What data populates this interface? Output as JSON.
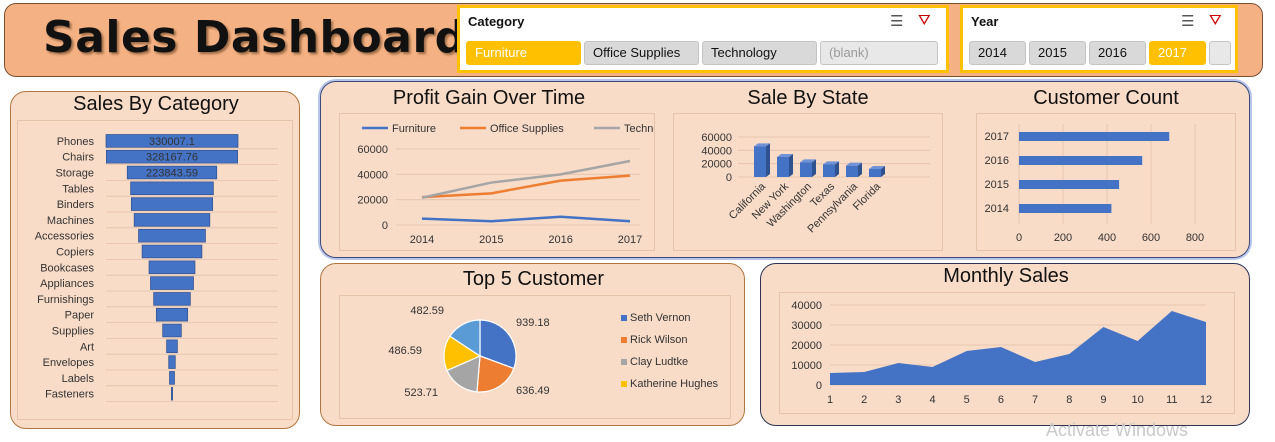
{
  "header": {
    "title": "Sales Dashboard"
  },
  "slicers": {
    "category": {
      "title": "Category",
      "options": [
        "Furniture",
        "Office Supplies",
        "Technology",
        "(blank)"
      ],
      "selected": "Furniture"
    },
    "year": {
      "title": "Year",
      "options": [
        "2014",
        "2015",
        "2016",
        "2017"
      ],
      "selected": "2017"
    },
    "icons": [
      "multi-select-icon",
      "clear-filter-icon"
    ]
  },
  "colors": {
    "accent": "#ffc000",
    "bar": "#4472c4",
    "orange": "#ed7d31",
    "gray": "#a5a5a5",
    "panel": "#f9dcc8",
    "header": "#f4b183"
  },
  "panels": {
    "sales_by_category": {
      "title": "Sales By Category"
    },
    "profit_gain": {
      "title": "Profit Gain Over Time"
    },
    "sale_by_state": {
      "title": "Sale By State"
    },
    "customer_count": {
      "title": "Customer Count"
    },
    "top5": {
      "title": "Top 5 Customer"
    },
    "monthly": {
      "title": "Monthly Sales"
    }
  },
  "watermark": "Activate Windows",
  "chart_data": [
    {
      "id": "sales_by_category",
      "type": "bar",
      "orientation": "horizontal-funnel",
      "title": "Sales By Category",
      "categories": [
        "Phones",
        "Chairs",
        "Storage",
        "Tables",
        "Binders",
        "Machines",
        "Accessories",
        "Copiers",
        "Bookcases",
        "Appliances",
        "Furnishings",
        "Paper",
        "Supplies",
        "Art",
        "Envelopes",
        "Labels",
        "Fasteners"
      ],
      "values": [
        330007.1,
        328167.76,
        223843.59,
        206965.53,
        203412.73,
        189238.63,
        167380.32,
        149528.03,
        114880.0,
        107532.16,
        91705.16,
        78479.21,
        46673.54,
        27118.79,
        16476.4,
        12486.31,
        3024.28
      ],
      "data_labels": [
        "330007.1",
        "328167.76",
        "223843.59"
      ]
    },
    {
      "id": "profit_gain",
      "type": "line",
      "title": "Profit Gain Over Time",
      "categories": [
        "2014",
        "2015",
        "2016",
        "2017"
      ],
      "series": [
        {
          "name": "Furniture",
          "color": "#4472c4",
          "values": [
            5000,
            3000,
            6500,
            3000
          ]
        },
        {
          "name": "Office Supplies",
          "color": "#ed7d31",
          "values": [
            22000,
            25000,
            35000,
            39000
          ]
        },
        {
          "name": "Technology",
          "color": "#a5a5a5",
          "values": [
            21500,
            33500,
            40000,
            50500
          ]
        }
      ],
      "yticks": [
        "0",
        "20000",
        "40000",
        "60000"
      ],
      "ylim": [
        0,
        60000
      ],
      "legend": "top"
    },
    {
      "id": "sale_by_state",
      "type": "bar",
      "title": "Sale By State",
      "categories": [
        "California",
        "New York",
        "Washington",
        "Texas",
        "Pennsylvania",
        "Florida"
      ],
      "values": [
        46000,
        30000,
        22000,
        19000,
        17000,
        12000
      ],
      "yticks": [
        "0",
        "20000",
        "40000",
        "60000"
      ],
      "ylim": [
        0,
        60000
      ]
    },
    {
      "id": "customer_count",
      "type": "bar",
      "orientation": "horizontal",
      "title": "Customer Count",
      "categories": [
        "2017",
        "2016",
        "2015",
        "2014"
      ],
      "values": [
        683,
        560,
        455,
        420
      ],
      "xticks": [
        "0",
        "200",
        "400",
        "600",
        "800"
      ],
      "xlim": [
        0,
        800
      ]
    },
    {
      "id": "top5",
      "type": "pie",
      "title": "Top 5 Customer",
      "labels": [
        "Seth Vernon",
        "Rick Wilson",
        "Clay Ludtke",
        "Katherine Hughes",
        ""
      ],
      "values": [
        939.18,
        636.49,
        523.71,
        486.59,
        482.59
      ],
      "value_labels": [
        "939.18",
        "636.49",
        "523.71",
        "486.59",
        "482.59"
      ],
      "colors": [
        "#4472c4",
        "#ed7d31",
        "#a5a5a5",
        "#ffc000",
        "#5b9bd5"
      ],
      "legend": "right"
    },
    {
      "id": "monthly",
      "type": "area",
      "title": "Monthly Sales",
      "categories": [
        "1",
        "2",
        "3",
        "4",
        "5",
        "6",
        "7",
        "8",
        "9",
        "10",
        "11",
        "12"
      ],
      "values": [
        6000,
        6500,
        11000,
        9000,
        17000,
        19000,
        11500,
        15500,
        29000,
        22000,
        37000,
        31500
      ],
      "yticks": [
        "0",
        "10000",
        "20000",
        "30000",
        "40000"
      ],
      "ylim": [
        0,
        40000
      ]
    }
  ]
}
